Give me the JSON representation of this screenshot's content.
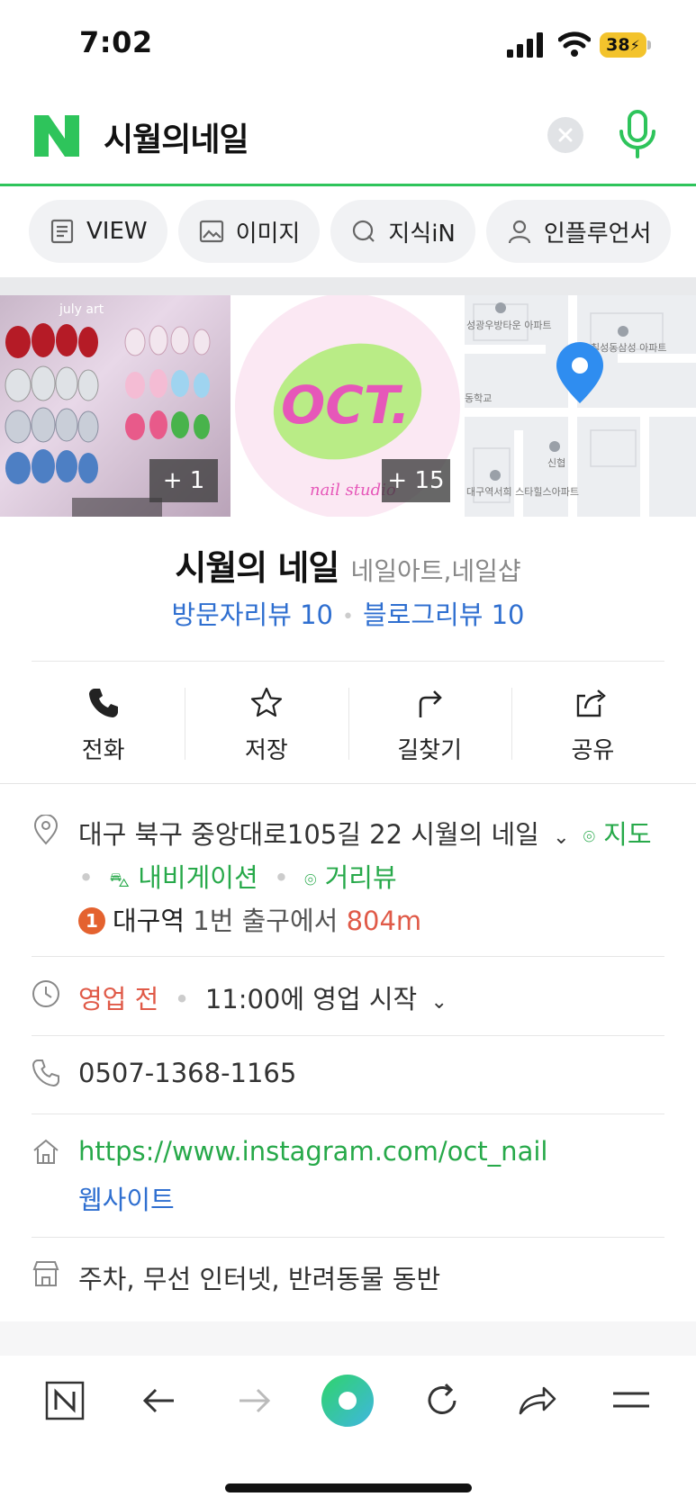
{
  "status": {
    "time": "7:02",
    "battery": "38"
  },
  "search": {
    "query": "시월의네일"
  },
  "tabs": [
    {
      "label": "VIEW",
      "icon": "document-icon"
    },
    {
      "label": "이미지",
      "icon": "image-icon"
    },
    {
      "label": "지식iN",
      "icon": "qna-icon"
    },
    {
      "label": "인플루언서",
      "icon": "person-icon"
    }
  ],
  "photos": {
    "badge1": "+ 1",
    "badge2": "+ 15",
    "photo1_caption": "july art",
    "photo2_logo": "OCT.",
    "photo2_sub": "nail studio",
    "map_labels": [
      "성광우방타운 아파트",
      "칠성동삼성 아파트",
      "동학교",
      "신협",
      "대구역서희 스타힐스아파트"
    ]
  },
  "place": {
    "name": "시월의 네일",
    "category": "네일아트,네일샵",
    "visitor_reviews": "방문자리뷰 10",
    "blog_reviews": "블로그리뷰 10"
  },
  "actions": [
    {
      "label": "전화",
      "icon": "phone-icon"
    },
    {
      "label": "저장",
      "icon": "star-icon"
    },
    {
      "label": "길찾기",
      "icon": "directions-icon"
    },
    {
      "label": "공유",
      "icon": "share-icon"
    }
  ],
  "info": {
    "address": "대구 북구 중앙대로105길 22 시월의 네일",
    "map_link": "지도",
    "navigation_link": "내비게이션",
    "streetview_link": "거리뷰",
    "station_num": "1",
    "station_name": "대구역",
    "station_exit": "1번 출구에서",
    "station_dist": "804m",
    "hours_status": "영업 전",
    "hours_text": "11:00에 영업 시작",
    "phone": "0507-1368-1165",
    "website_url": "https://www.instagram.com/oct_nail",
    "website_label": "웹사이트",
    "amenities": "주차, 무선 인터넷, 반려동물 동반"
  },
  "colors": {
    "accent_green": "#27a94a",
    "link_blue": "#2f6fd0",
    "alert_red": "#e05a48"
  }
}
